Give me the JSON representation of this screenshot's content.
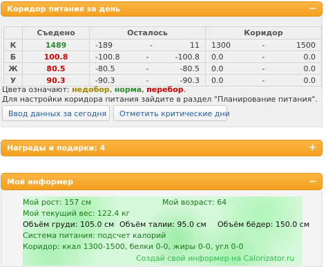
{
  "corridor": {
    "title": "Коридор питания за день",
    "collapse": "−",
    "headers": {
      "eaten": "Съедено",
      "remaining": "Осталось",
      "corridor": "Коридор"
    },
    "rows": [
      {
        "label": "К",
        "eaten": "1489",
        "rem_a": "-189",
        "rem_b": "11",
        "cor_a": "1300",
        "cor_b": "1500"
      },
      {
        "label": "Б",
        "eaten": "100.8",
        "rem_a": "-100.8",
        "rem_b": "-100.8",
        "cor_a": "0.0",
        "cor_b": "0.0"
      },
      {
        "label": "Ж",
        "eaten": "80.5",
        "rem_a": "-80.5",
        "rem_b": "-80.5",
        "cor_a": "0.0",
        "cor_b": "0.0"
      },
      {
        "label": "У",
        "eaten": "90.3",
        "rem_a": "-90.3",
        "rem_b": "-90.3",
        "cor_a": "0.0",
        "cor_b": "0.0"
      }
    ],
    "dash": "-",
    "legend_prefix": "Цвета означают:",
    "legend_under": "недобор",
    "legend_norm": "норма",
    "legend_over": "перебор",
    "sep": ",",
    "dot": ".",
    "note": "Для настройки коридора питания зайдите в раздел \"Планирование питания\".",
    "btn_today": "Ввод данных за сегодня",
    "btn_critical": "Отметить критические дни"
  },
  "awards": {
    "title": "Награды и подарки: 4",
    "expand": "+"
  },
  "informer": {
    "title": "Мой информер",
    "collapse": "−",
    "height": "Мой рост: 157 см",
    "age": "Мой возраст: 64",
    "weight": "Мой текущий вес: 122.4 кг",
    "chest": "Объём груди: 105.0 см",
    "waist": "Объём талии: 95.0 см",
    "hips": "Объём бёдер: 150.0 см",
    "system": "Система питания: подсчет калорий",
    "corridor": "Коридор: ккал 1300-1500, белки 0-0, жиры 0-0, угл 0-0",
    "link": "Создай свой информер на Calorizator.ru"
  },
  "colors": {
    "header": "#f4a020",
    "green": "#2e8b2e",
    "red": "#cc0000",
    "yellow": "#a08600",
    "link": "#1e5fa8"
  }
}
